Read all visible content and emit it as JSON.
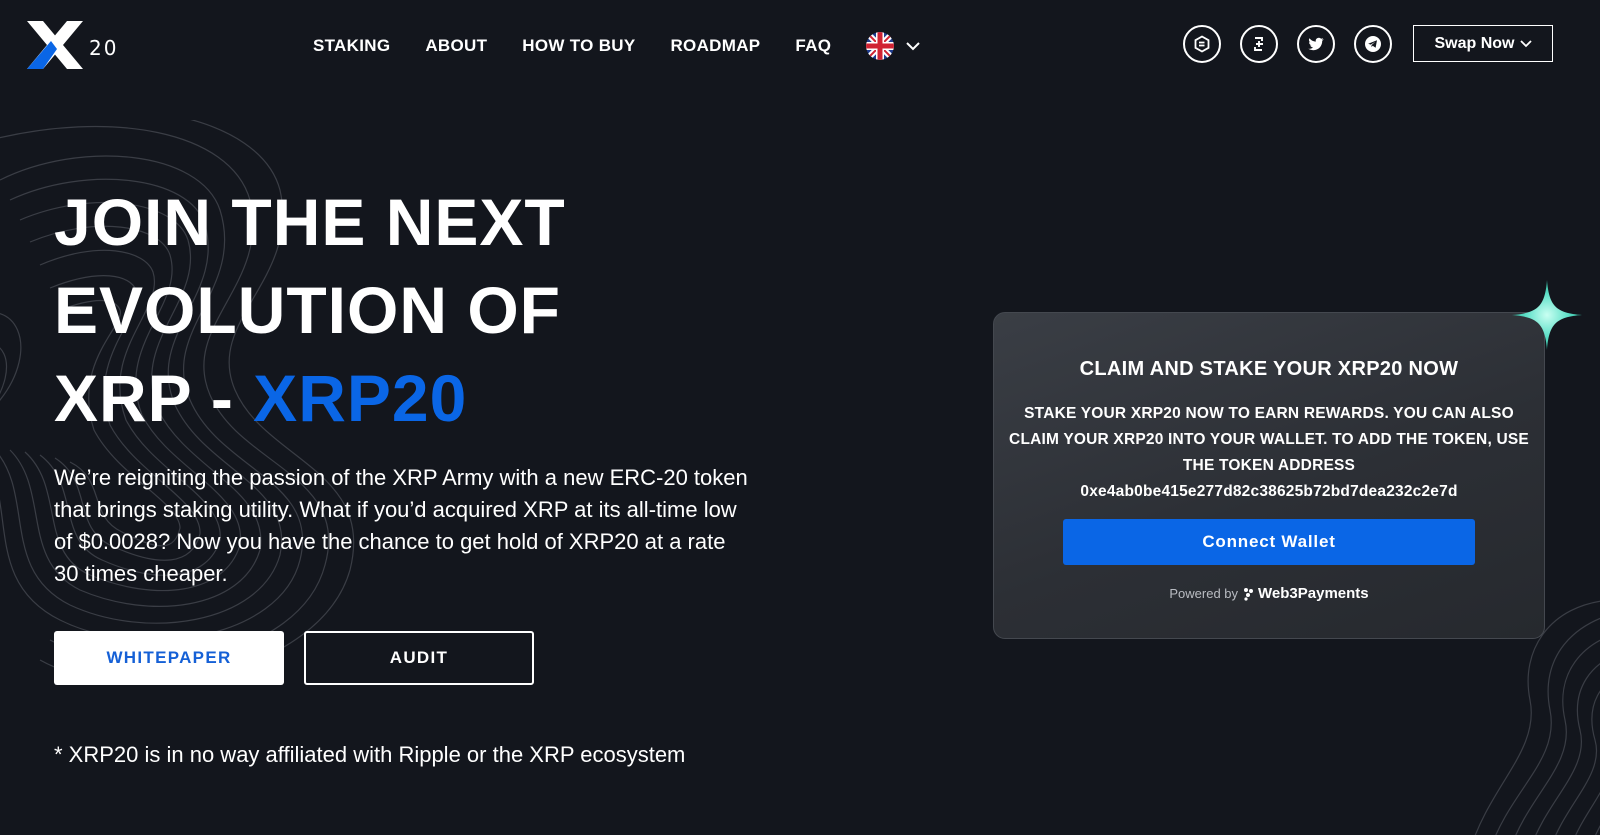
{
  "header": {
    "logo_text": "20",
    "nav": [
      {
        "label": "STAKING"
      },
      {
        "label": "ABOUT"
      },
      {
        "label": "HOW TO BUY"
      },
      {
        "label": "ROADMAP"
      },
      {
        "label": "FAQ"
      }
    ],
    "language_icon": "uk-flag-icon",
    "socials": [
      "etherscan-icon",
      "dextools-icon",
      "twitter-icon",
      "telegram-icon"
    ],
    "swap_label": "Swap Now"
  },
  "hero": {
    "title_line1": "JOIN THE NEXT",
    "title_line2": "EVOLUTION OF",
    "title_line3_prefix": "XRP - ",
    "title_line3_accent": "XRP20",
    "description": "We’re reigniting the passion of the XRP Army with a new ERC-20 token that brings staking utility. What if you’d acquired XRP at its all-time low of $0.0028? Now you have the chance to get hold of XRP20 at a rate 30 times cheaper.",
    "whitepaper_label": "WHITEPAPER",
    "audit_label": "AUDIT",
    "disclaimer": "* XRP20 is in no way affiliated with Ripple or the XRP ecosystem"
  },
  "claim_card": {
    "title": "CLAIM AND STAKE YOUR XRP20 NOW",
    "text": "STAKE YOUR XRP20 NOW TO EARN REWARDS. YOU CAN ALSO CLAIM YOUR XRP20 INTO YOUR WALLET. TO ADD THE TOKEN, USE THE TOKEN ADDRESS",
    "token_address": "0xe4ab0be415e277d82c38625b72bd7dea232c2e7d",
    "connect_label": "Connect Wallet",
    "powered_by": "Powered by",
    "powered_brand": "Web3Payments"
  },
  "colors": {
    "background": "#13161d",
    "accent": "#0a66e6",
    "card": "#34373d",
    "sparkle": "#5ee0c8"
  }
}
